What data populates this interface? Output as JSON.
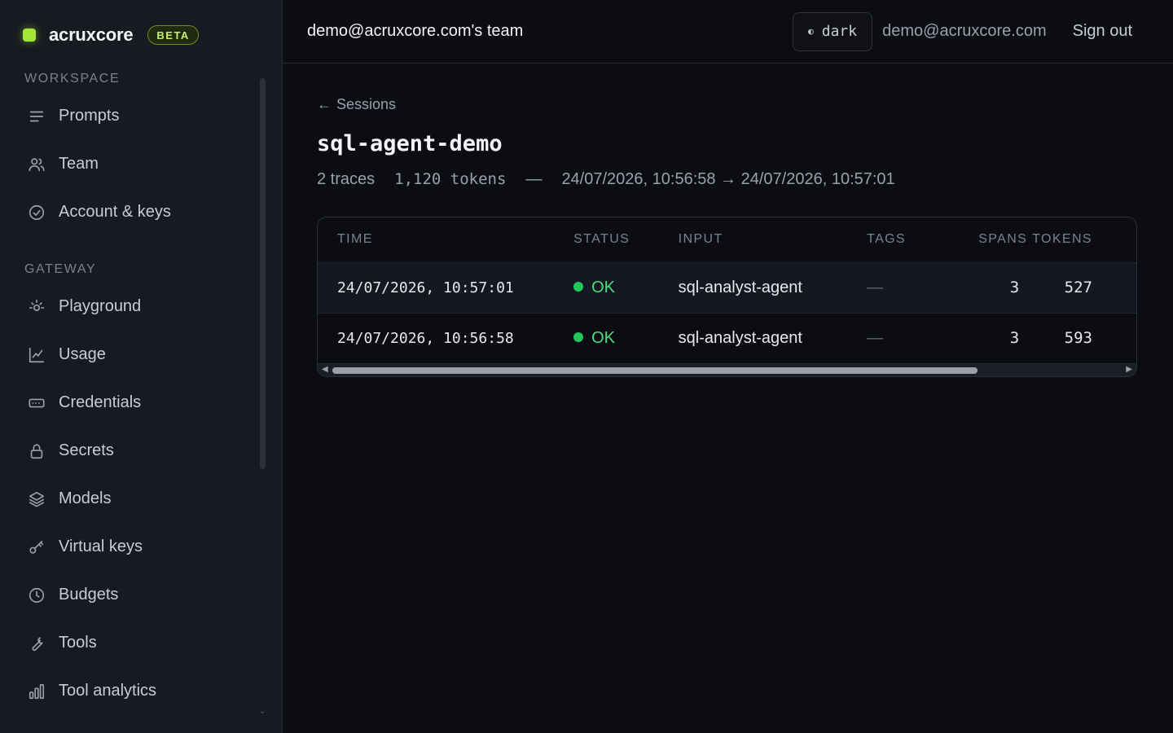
{
  "brand": {
    "name": "acruxcore",
    "badge": "BETA"
  },
  "sidebar": {
    "sections": [
      {
        "label": "WORKSPACE",
        "items": [
          {
            "label": "Prompts",
            "icon": "lines-icon"
          },
          {
            "label": "Team",
            "icon": "users-icon"
          },
          {
            "label": "Account & keys",
            "icon": "check-circle-icon"
          }
        ]
      },
      {
        "label": "GATEWAY",
        "items": [
          {
            "label": "Playground",
            "icon": "sun-icon"
          },
          {
            "label": "Usage",
            "icon": "line-chart-icon"
          },
          {
            "label": "Credentials",
            "icon": "card-icon"
          },
          {
            "label": "Secrets",
            "icon": "lock-icon"
          },
          {
            "label": "Models",
            "icon": "layers-icon"
          },
          {
            "label": "Virtual keys",
            "icon": "key-icon"
          },
          {
            "label": "Budgets",
            "icon": "clock-icon"
          },
          {
            "label": "Tools",
            "icon": "wrench-icon"
          },
          {
            "label": "Tool analytics",
            "icon": "bar-chart-icon"
          }
        ]
      }
    ]
  },
  "header": {
    "team": "demo@acruxcore.com's team",
    "theme_label": "dark",
    "user_email": "demo@acruxcore.com",
    "signout_label": "Sign out"
  },
  "page": {
    "back_label": "Sessions",
    "title": "sql-agent-demo",
    "traces": "2 traces",
    "tokens": "1,120 tokens",
    "separator": "—",
    "range": "24/07/2026, 10:56:58 → 24/07/2026, 10:57:01"
  },
  "table": {
    "columns": [
      "TIME",
      "STATUS",
      "INPUT",
      "TAGS",
      "SPANS",
      "TOKENS"
    ],
    "rows": [
      {
        "time": "24/07/2026, 10:57:01",
        "status": "OK",
        "input": "sql-analyst-agent",
        "tags": "—",
        "spans": "3",
        "tokens": "527"
      },
      {
        "time": "24/07/2026, 10:56:58",
        "status": "OK",
        "input": "sql-analyst-agent",
        "tags": "—",
        "spans": "3",
        "tokens": "593"
      }
    ]
  },
  "colors": {
    "accent": "#a3e635",
    "status_ok": "#22c55e",
    "background": "#0b0d12",
    "sidebar": "#171a20"
  }
}
